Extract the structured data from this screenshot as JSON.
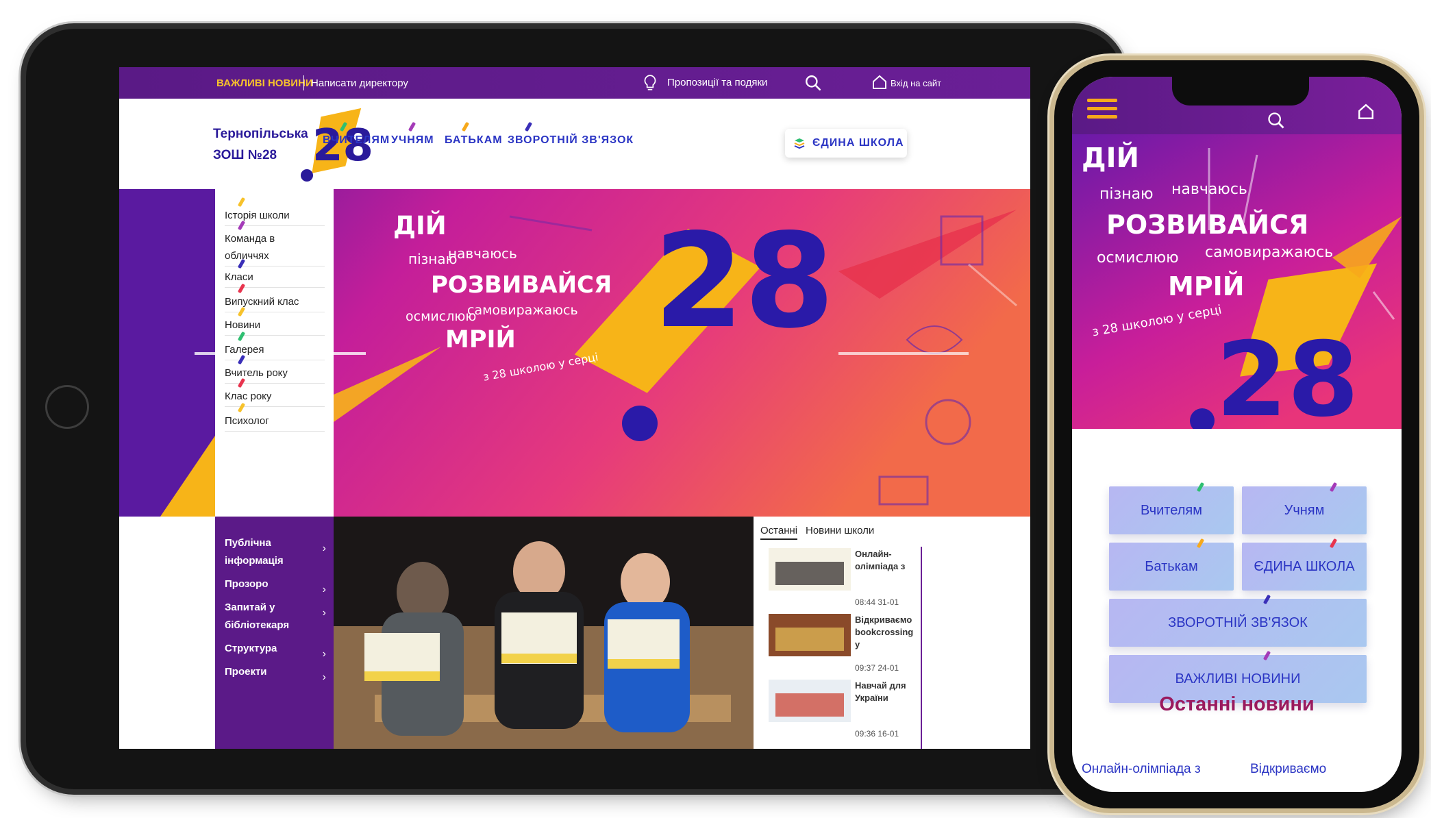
{
  "colors": {
    "brand_purple": "#5b1a88",
    "accent_yellow": "#f7c22b",
    "nav_blue": "#2b35c4",
    "heading_magenta": "#9a1a5e"
  },
  "tablet": {
    "topbar": {
      "important_news": "ВАЖЛИВІ НОВИНИ",
      "write_director": "Написати директору",
      "proposals": "Пропозиції та подяки",
      "login": "Вхід на сайт",
      "icons": [
        "lightbulb-icon",
        "search-icon",
        "home-icon"
      ]
    },
    "header": {
      "school_name_line1": "Тернопільська",
      "school_name_line2": "ЗОШ №28",
      "logo_number": "28",
      "nav": [
        {
          "label": "ВЧИТЕЛЯМ",
          "pen": "#2fbf71"
        },
        {
          "label": "УЧНЯМ",
          "pen": "#a43bb8"
        },
        {
          "label": "БАТЬКАМ",
          "pen": "#f7a91b"
        },
        {
          "label": "ЗВОРОТНІЙ ЗВ'ЯЗОК",
          "pen": "#3a2fb8"
        }
      ],
      "unified_school": "ЄДИНА ШКОЛА"
    },
    "side_menu": [
      {
        "label_lines": [
          "Історія школи"
        ],
        "pen": "#f7c22b"
      },
      {
        "label_lines": [
          "Команда в",
          "обличчях"
        ],
        "pen": "#a43bb8"
      },
      {
        "label_lines": [
          "Класи"
        ],
        "pen": "#3a2fb8"
      },
      {
        "label_lines": [
          "Випускний клас"
        ],
        "pen": "#e8344e"
      },
      {
        "label_lines": [
          "Новини"
        ],
        "pen": "#f7c22b"
      },
      {
        "label_lines": [
          "Галерея"
        ],
        "pen": "#2fbf71"
      },
      {
        "label_lines": [
          "Вчитель року"
        ],
        "pen": "#3a2fb8"
      },
      {
        "label_lines": [
          "Клас року"
        ],
        "pen": "#e8344e"
      },
      {
        "label_lines": [
          "Психолог"
        ],
        "pen": "#f7c22b"
      }
    ],
    "hero": {
      "word_act": "ДІЙ",
      "word_learn": "пізнаю",
      "word_study": "навчаюсь",
      "word_develop": "РОЗВИВАЙСЯ",
      "word_comprehend": "осмислюю",
      "word_express": "самовиражаюсь",
      "word_dream": "МРІЙ",
      "tagline": "з 28 школою у серці",
      "number": "28"
    },
    "purple_menu": [
      {
        "label_lines": [
          "Публічна",
          "інформація"
        ]
      },
      {
        "label_lines": [
          "Прозоро"
        ]
      },
      {
        "label_lines": [
          "Запитай у",
          "бібліотекаря"
        ]
      },
      {
        "label_lines": [
          "Структура"
        ]
      },
      {
        "label_lines": [
          "Проекти"
        ]
      }
    ],
    "chevron": "›",
    "news_tabs": [
      "Останні",
      "Новини школи"
    ],
    "news": [
      {
        "title_lines": [
          "Онлайн-",
          "олімпіада з"
        ],
        "time": "08:44 31-01"
      },
      {
        "title_lines": [
          "Відкриваємо",
          "bookcrossing у"
        ],
        "time": "09:37 24-01"
      },
      {
        "title_lines": [
          "Навчай для",
          "України"
        ],
        "time": "09:36 16-01"
      }
    ]
  },
  "phone": {
    "icons": [
      "menu-icon",
      "search-icon",
      "home-icon"
    ],
    "hero": {
      "word_act": "ДІЙ",
      "word_learn": "пізнаю",
      "word_study": "навчаюсь",
      "word_develop": "РОЗВИВАЙСЯ",
      "word_comprehend": "осмислюю",
      "word_express": "самовиражаюсь",
      "word_dream": "МРІЙ",
      "tagline": "з 28 школою у серці",
      "number": "28"
    },
    "tiles": [
      {
        "label": "Вчителям",
        "pen": "#2fbf71"
      },
      {
        "label": "Учням",
        "pen": "#a43bb8"
      },
      {
        "label": "Батькам",
        "pen": "#f7a91b"
      },
      {
        "label": "ЄДИНА ШКОЛА",
        "pen": "#e8344e"
      },
      {
        "label": "ЗВОРОТНІЙ ЗВ'ЯЗОК",
        "pen": "#3a2fb8"
      },
      {
        "label": "ВАЖЛИВІ НОВИНИ",
        "pen": "#a43bb8"
      }
    ],
    "latest_news_heading": "Останні новини",
    "news_preview": [
      "Онлайн-олімпіада з",
      "Відкриваємо"
    ]
  }
}
